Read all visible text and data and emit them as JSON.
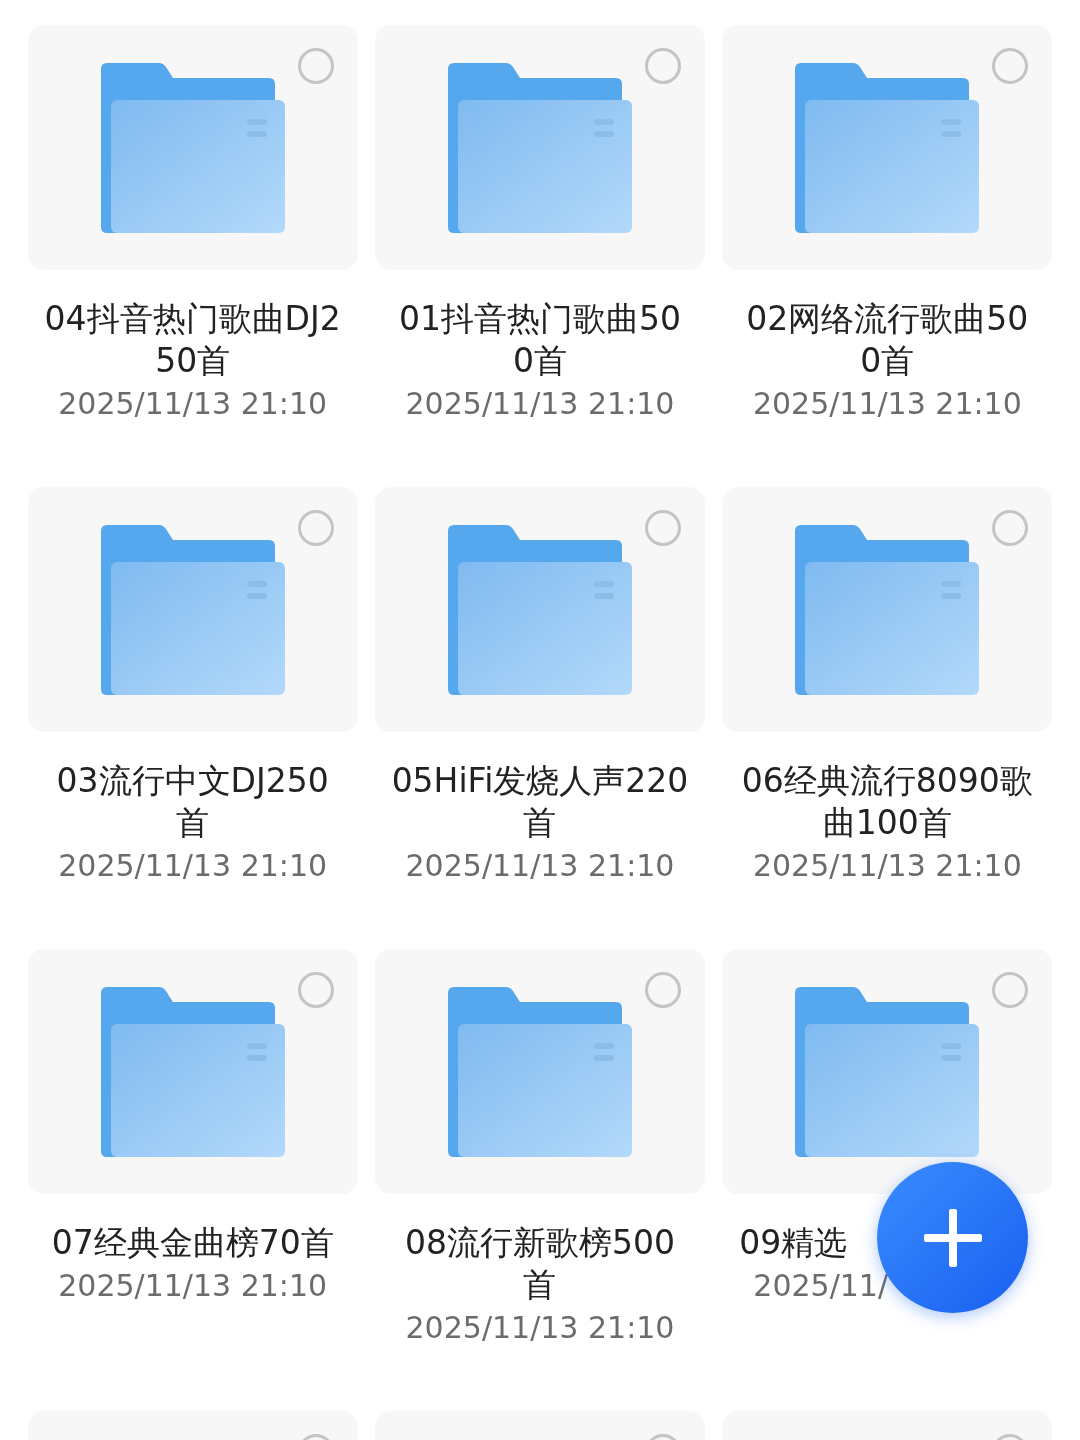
{
  "folders": [
    {
      "name": "04抖音热门歌曲DJ250首",
      "date": "2025/11/13 21:10",
      "selected": false
    },
    {
      "name": "01抖音热门歌曲500首",
      "date": "2025/11/13 21:10",
      "selected": false
    },
    {
      "name": "02网络流行歌曲500首",
      "date": "2025/11/13 21:10",
      "selected": false
    },
    {
      "name": "03流行中文DJ250首",
      "date": "2025/11/13 21:10",
      "selected": false
    },
    {
      "name": "05HiFi发烧人声220首",
      "date": "2025/11/13 21:10",
      "selected": false
    },
    {
      "name": "06经典流行8090歌曲100首",
      "date": "2025/11/13 21:10",
      "selected": false
    },
    {
      "name": "07经典金曲榜70首",
      "date": "2025/11/13 21:10",
      "selected": false
    },
    {
      "name": "08流行新歌榜500首",
      "date": "2025/11/13 21:10",
      "selected": false
    },
    {
      "name": "09精选",
      "date": "2025/11/",
      "selected": false
    },
    {
      "selected": false
    },
    {
      "selected": false
    },
    {
      "selected": false
    }
  ]
}
